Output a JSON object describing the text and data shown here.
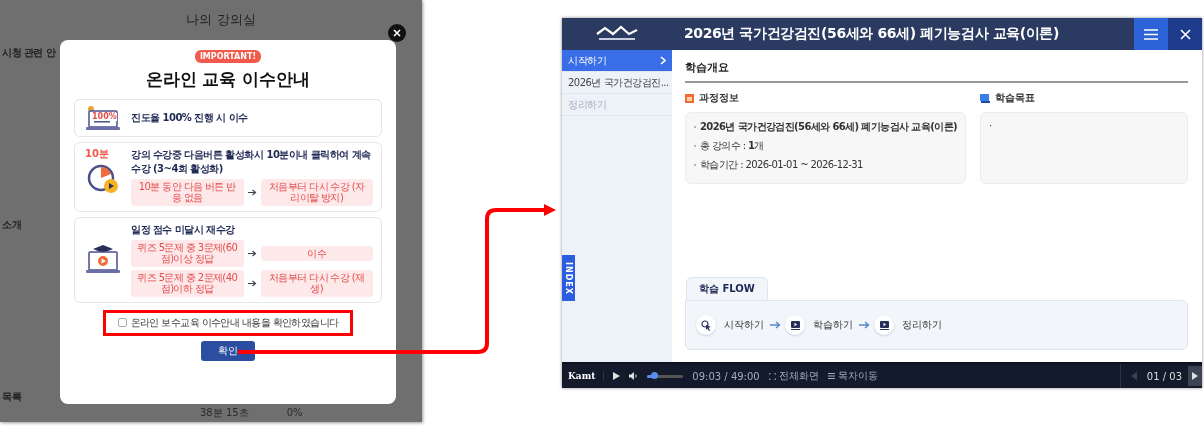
{
  "left_screen": {
    "page_title": "나의 강의실",
    "background_headings": [
      "시청 관련 안",
      "소개",
      "목록"
    ],
    "background_row": [
      "38분 15초",
      "0%"
    ],
    "modal": {
      "badge": "IMPORTANT!",
      "title": "온라인 교육 이수안내",
      "cards": [
        {
          "kind": "laptop",
          "icon_label": "100%",
          "text": "진도율 100% 진행 시 이수"
        },
        {
          "kind": "clock",
          "icon_label": "10분",
          "text": "강의 수강중 다음버튼 활성화시 10분이내 클릭하여 계속 수강 (3~4회 활성화)",
          "rules": [
            {
              "condition": "10분 동안 다음 버튼 반응 없음",
              "result": "처음부터 다시 수강 (자리이탈 방지)"
            }
          ]
        },
        {
          "kind": "graduate",
          "text": "일정 점수 미달시 재수강",
          "rules": [
            {
              "condition": "퀴즈 5문제 중 3문제(60점)이상 정답",
              "result": "이수"
            },
            {
              "condition": "퀴즈 5문제 중 2문제(40점)이하 정답",
              "result": "처음부터 다시 수강 (재생)"
            }
          ]
        }
      ],
      "confirm": {
        "label": "온라인 보수교육 이수안내 내용을 확인하였습니다",
        "checked": false
      },
      "button": "확인"
    }
  },
  "right_screen": {
    "title": "2026년 국가건강검진(56세와 66세) 폐기능검사 교육(이론)",
    "sidebar": [
      {
        "label": "시작하기",
        "selected": true,
        "disabled": false
      },
      {
        "label": "2026년 국가건강검진...",
        "selected": false,
        "disabled": false
      },
      {
        "label": "정리하기",
        "selected": false,
        "disabled": true
      }
    ],
    "index_tab": "INDEX",
    "heading": "학습개요",
    "course_info": {
      "title": "과정정보",
      "items": [
        "**2026년 국가건강검진(56세와 66세) 폐기능검사 교육(이론)**",
        "총 강의수 : **1**개",
        "학습기간 : 2026-01-01 ~ 2026-12-31"
      ]
    },
    "goals": {
      "title": "학습목표",
      "items": [
        "·"
      ]
    },
    "flow": {
      "tab": "학습 FLOW",
      "steps": [
        {
          "kind": "cursor",
          "label": "시작하기"
        },
        {
          "kind": "video",
          "label": "학습하기"
        },
        {
          "kind": "video",
          "label": "정리하기"
        }
      ]
    },
    "player": {
      "brand": "Kamt",
      "level": 0.185,
      "time": "09:03 / 49:00",
      "fullscreen": "전체화면",
      "toc": "목차이동",
      "page": "01 / 03",
      "prev_disabled": true
    }
  }
}
